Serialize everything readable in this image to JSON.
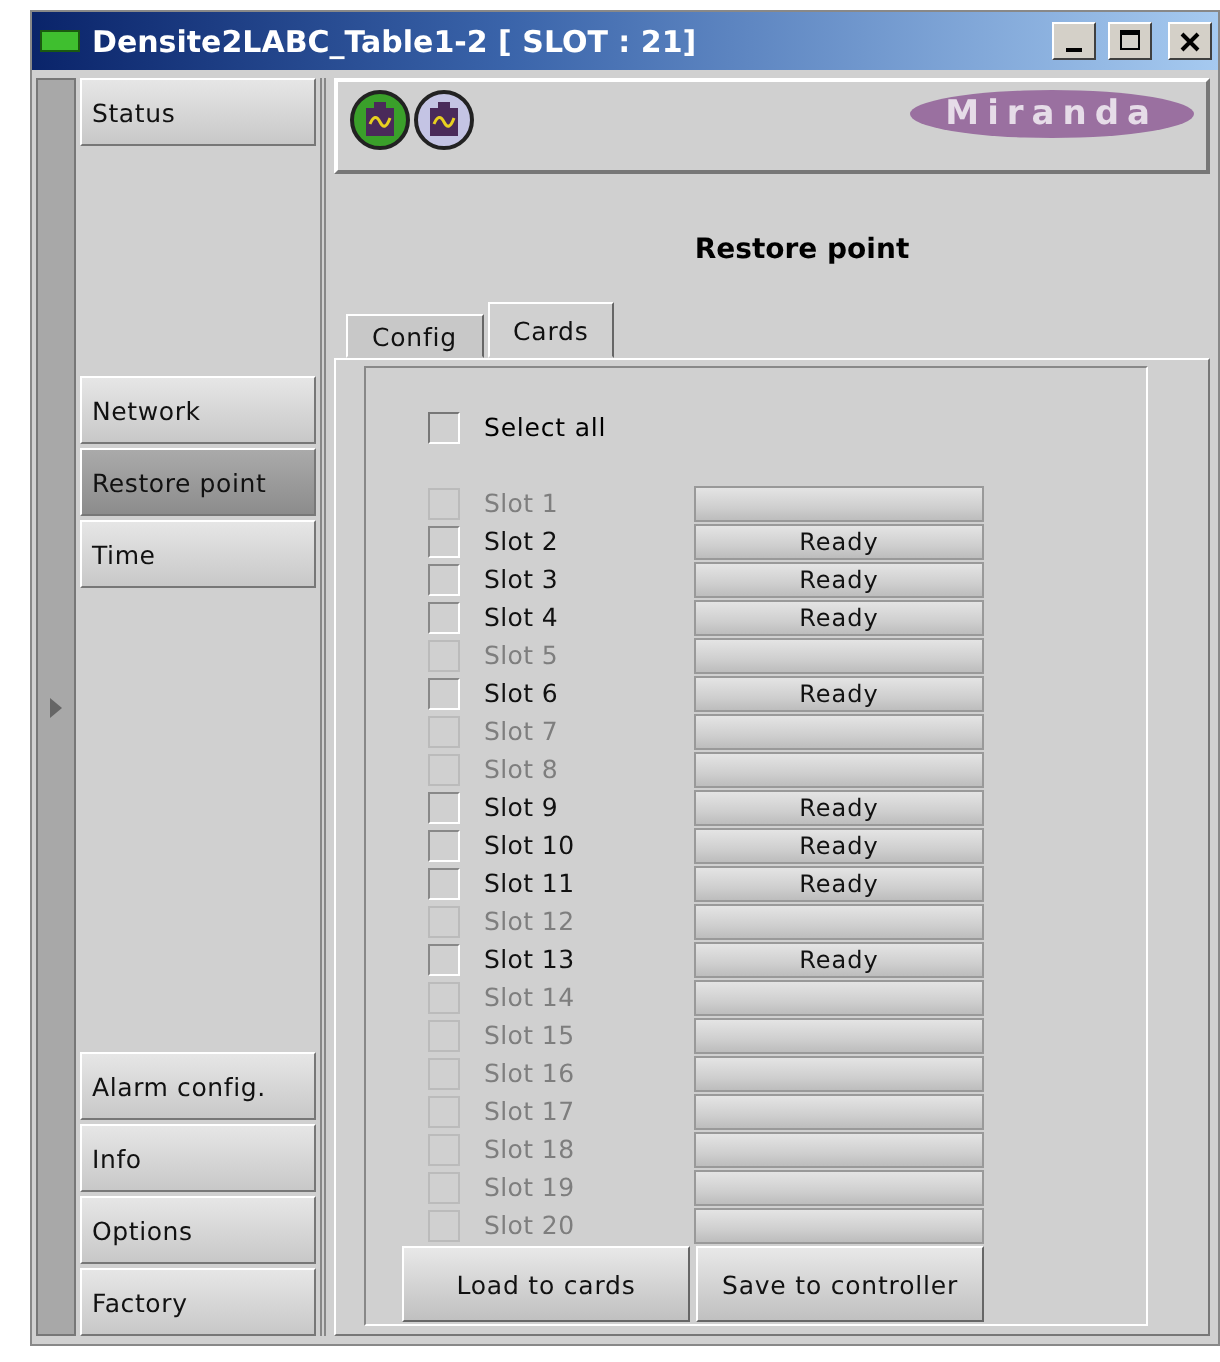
{
  "window": {
    "title": "Densite2LABC_Table1-2 [ SLOT : 21]"
  },
  "sidebar": {
    "groups": [
      {
        "items": [
          {
            "label": "Status",
            "selected": false
          }
        ]
      },
      {
        "items": [
          {
            "label": "Network",
            "selected": false
          },
          {
            "label": "Restore point",
            "selected": true
          },
          {
            "label": "Time",
            "selected": false
          }
        ]
      },
      {
        "items": [
          {
            "label": "Alarm config.",
            "selected": false
          },
          {
            "label": "Info",
            "selected": false
          },
          {
            "label": "Options",
            "selected": false
          },
          {
            "label": "Factory",
            "selected": false
          }
        ]
      }
    ]
  },
  "header": {
    "status_icons": [
      {
        "color": "#3aa02a"
      },
      {
        "color": "#c4c4e4"
      }
    ],
    "logo": "Miranda"
  },
  "page_title": "Restore point",
  "tabs": [
    {
      "label": "Config",
      "selected": false
    },
    {
      "label": "Cards",
      "selected": true
    }
  ],
  "select_all": {
    "label": "Select all",
    "checked": false
  },
  "slots": [
    {
      "label": "Slot 1",
      "disabled": true,
      "checked": false
    },
    {
      "label": "Slot 2",
      "disabled": false,
      "checked": false,
      "status": "Ready"
    },
    {
      "label": "Slot 3",
      "disabled": false,
      "checked": false,
      "status": "Ready"
    },
    {
      "label": "Slot 4",
      "disabled": false,
      "checked": false,
      "status": "Ready"
    },
    {
      "label": "Slot 5",
      "disabled": true,
      "checked": false
    },
    {
      "label": "Slot 6",
      "disabled": false,
      "checked": false,
      "status": "Ready"
    },
    {
      "label": "Slot 7",
      "disabled": true,
      "checked": false
    },
    {
      "label": "Slot 8",
      "disabled": true,
      "checked": false
    },
    {
      "label": "Slot 9",
      "disabled": false,
      "checked": false,
      "status": "Ready"
    },
    {
      "label": "Slot 10",
      "disabled": false,
      "checked": false,
      "status": "Ready"
    },
    {
      "label": "Slot 11",
      "disabled": false,
      "checked": false,
      "status": "Ready"
    },
    {
      "label": "Slot 12",
      "disabled": true,
      "checked": false
    },
    {
      "label": "Slot 13",
      "disabled": false,
      "checked": false,
      "status": "Ready"
    },
    {
      "label": "Slot 14",
      "disabled": true,
      "checked": false
    },
    {
      "label": "Slot 15",
      "disabled": true,
      "checked": false
    },
    {
      "label": "Slot 16",
      "disabled": true,
      "checked": false
    },
    {
      "label": "Slot 17",
      "disabled": true,
      "checked": false
    },
    {
      "label": "Slot 18",
      "disabled": true,
      "checked": false
    },
    {
      "label": "Slot 19",
      "disabled": true,
      "checked": false
    },
    {
      "label": "Slot 20",
      "disabled": true,
      "checked": false
    }
  ],
  "buttons": [
    "Load to cards",
    "Save to controller"
  ]
}
